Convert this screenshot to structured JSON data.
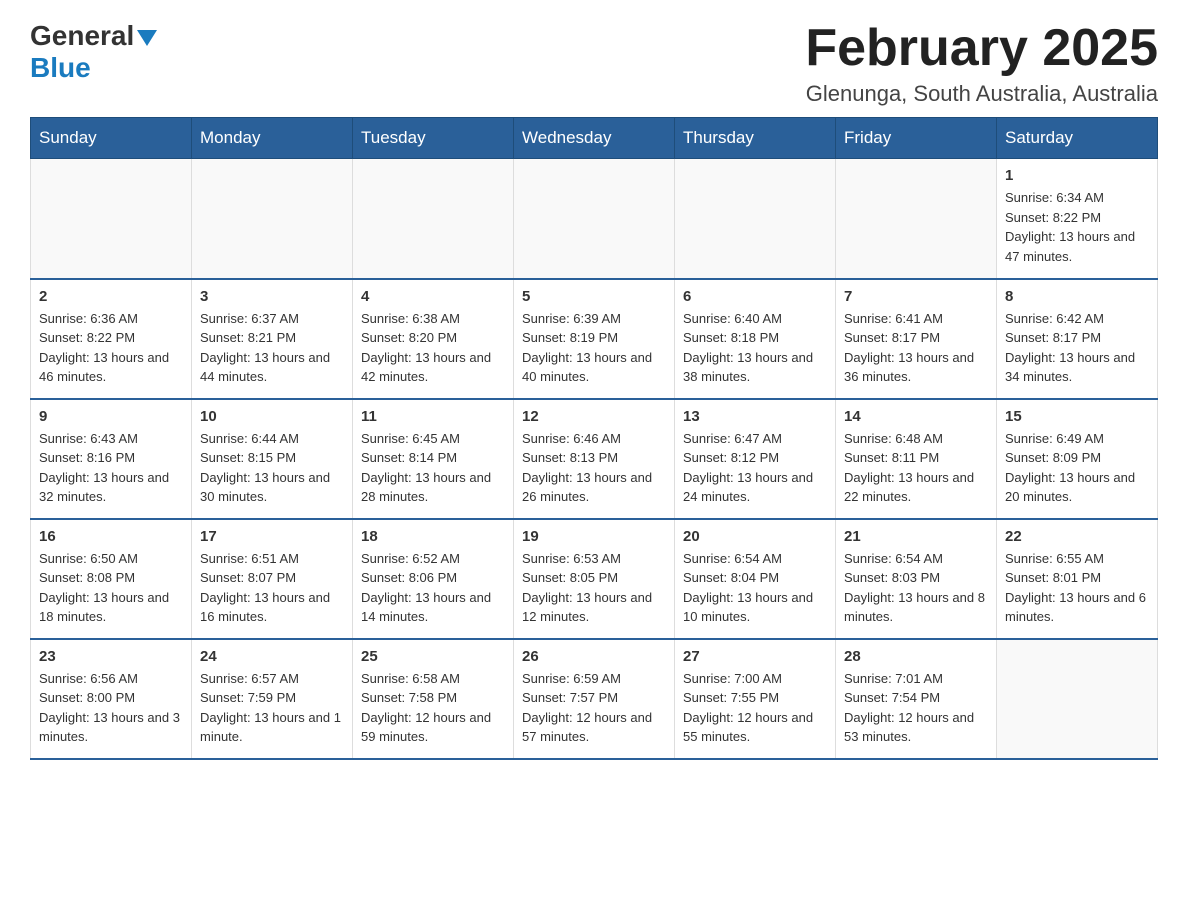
{
  "header": {
    "logo_general": "General",
    "logo_blue": "Blue",
    "month_title": "February 2025",
    "location": "Glenunga, South Australia, Australia"
  },
  "weekdays": [
    "Sunday",
    "Monday",
    "Tuesday",
    "Wednesday",
    "Thursday",
    "Friday",
    "Saturday"
  ],
  "weeks": [
    [
      {
        "day": "",
        "info": ""
      },
      {
        "day": "",
        "info": ""
      },
      {
        "day": "",
        "info": ""
      },
      {
        "day": "",
        "info": ""
      },
      {
        "day": "",
        "info": ""
      },
      {
        "day": "",
        "info": ""
      },
      {
        "day": "1",
        "info": "Sunrise: 6:34 AM\nSunset: 8:22 PM\nDaylight: 13 hours and 47 minutes."
      }
    ],
    [
      {
        "day": "2",
        "info": "Sunrise: 6:36 AM\nSunset: 8:22 PM\nDaylight: 13 hours and 46 minutes."
      },
      {
        "day": "3",
        "info": "Sunrise: 6:37 AM\nSunset: 8:21 PM\nDaylight: 13 hours and 44 minutes."
      },
      {
        "day": "4",
        "info": "Sunrise: 6:38 AM\nSunset: 8:20 PM\nDaylight: 13 hours and 42 minutes."
      },
      {
        "day": "5",
        "info": "Sunrise: 6:39 AM\nSunset: 8:19 PM\nDaylight: 13 hours and 40 minutes."
      },
      {
        "day": "6",
        "info": "Sunrise: 6:40 AM\nSunset: 8:18 PM\nDaylight: 13 hours and 38 minutes."
      },
      {
        "day": "7",
        "info": "Sunrise: 6:41 AM\nSunset: 8:17 PM\nDaylight: 13 hours and 36 minutes."
      },
      {
        "day": "8",
        "info": "Sunrise: 6:42 AM\nSunset: 8:17 PM\nDaylight: 13 hours and 34 minutes."
      }
    ],
    [
      {
        "day": "9",
        "info": "Sunrise: 6:43 AM\nSunset: 8:16 PM\nDaylight: 13 hours and 32 minutes."
      },
      {
        "day": "10",
        "info": "Sunrise: 6:44 AM\nSunset: 8:15 PM\nDaylight: 13 hours and 30 minutes."
      },
      {
        "day": "11",
        "info": "Sunrise: 6:45 AM\nSunset: 8:14 PM\nDaylight: 13 hours and 28 minutes."
      },
      {
        "day": "12",
        "info": "Sunrise: 6:46 AM\nSunset: 8:13 PM\nDaylight: 13 hours and 26 minutes."
      },
      {
        "day": "13",
        "info": "Sunrise: 6:47 AM\nSunset: 8:12 PM\nDaylight: 13 hours and 24 minutes."
      },
      {
        "day": "14",
        "info": "Sunrise: 6:48 AM\nSunset: 8:11 PM\nDaylight: 13 hours and 22 minutes."
      },
      {
        "day": "15",
        "info": "Sunrise: 6:49 AM\nSunset: 8:09 PM\nDaylight: 13 hours and 20 minutes."
      }
    ],
    [
      {
        "day": "16",
        "info": "Sunrise: 6:50 AM\nSunset: 8:08 PM\nDaylight: 13 hours and 18 minutes."
      },
      {
        "day": "17",
        "info": "Sunrise: 6:51 AM\nSunset: 8:07 PM\nDaylight: 13 hours and 16 minutes."
      },
      {
        "day": "18",
        "info": "Sunrise: 6:52 AM\nSunset: 8:06 PM\nDaylight: 13 hours and 14 minutes."
      },
      {
        "day": "19",
        "info": "Sunrise: 6:53 AM\nSunset: 8:05 PM\nDaylight: 13 hours and 12 minutes."
      },
      {
        "day": "20",
        "info": "Sunrise: 6:54 AM\nSunset: 8:04 PM\nDaylight: 13 hours and 10 minutes."
      },
      {
        "day": "21",
        "info": "Sunrise: 6:54 AM\nSunset: 8:03 PM\nDaylight: 13 hours and 8 minutes."
      },
      {
        "day": "22",
        "info": "Sunrise: 6:55 AM\nSunset: 8:01 PM\nDaylight: 13 hours and 6 minutes."
      }
    ],
    [
      {
        "day": "23",
        "info": "Sunrise: 6:56 AM\nSunset: 8:00 PM\nDaylight: 13 hours and 3 minutes."
      },
      {
        "day": "24",
        "info": "Sunrise: 6:57 AM\nSunset: 7:59 PM\nDaylight: 13 hours and 1 minute."
      },
      {
        "day": "25",
        "info": "Sunrise: 6:58 AM\nSunset: 7:58 PM\nDaylight: 12 hours and 59 minutes."
      },
      {
        "day": "26",
        "info": "Sunrise: 6:59 AM\nSunset: 7:57 PM\nDaylight: 12 hours and 57 minutes."
      },
      {
        "day": "27",
        "info": "Sunrise: 7:00 AM\nSunset: 7:55 PM\nDaylight: 12 hours and 55 minutes."
      },
      {
        "day": "28",
        "info": "Sunrise: 7:01 AM\nSunset: 7:54 PM\nDaylight: 12 hours and 53 minutes."
      },
      {
        "day": "",
        "info": ""
      }
    ]
  ]
}
